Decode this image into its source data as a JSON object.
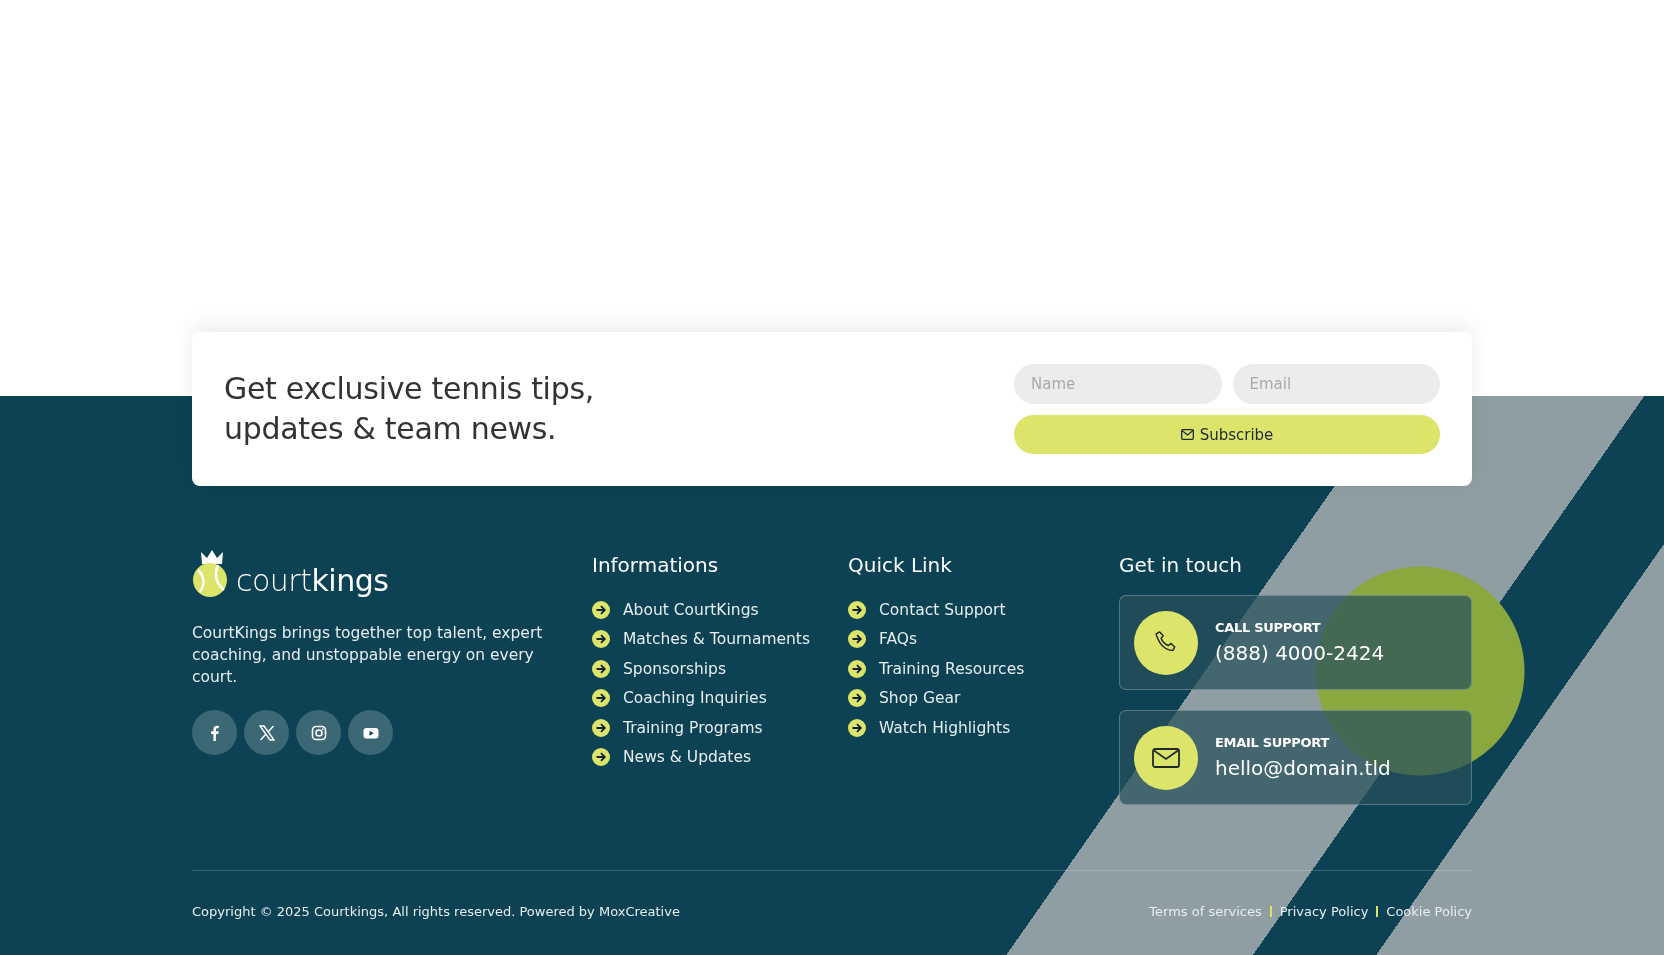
{
  "newsletter": {
    "heading": "Get exclusive tennis tips,\nupdates & team news.",
    "name_field": {
      "placeholder": "Name"
    },
    "email_field": {
      "placeholder": "Email"
    },
    "button": "Subscribe"
  },
  "brand": {
    "logo": "court**kings**",
    "description": "CourtKings brings together top talent, expert coaching, and unstoppable energy on every court.",
    "socials": [
      {
        "kind": "facebook"
      },
      {
        "kind": "x"
      },
      {
        "kind": "instagram"
      },
      {
        "kind": "youtube"
      }
    ]
  },
  "informations": {
    "title": "Informations",
    "links": [
      "About CourtKings",
      "Matches & Tournaments",
      "Sponsorships",
      "Coaching Inquiries",
      "Training Programs",
      "News & Updates"
    ]
  },
  "quick_link": {
    "title": "Quick Link",
    "links": [
      "Contact Support",
      "FAQs",
      "Training Resources",
      "Shop Gear",
      "Watch Highlights"
    ]
  },
  "get_in_touch": {
    "title": "Get in touch",
    "contacts": [
      {
        "kind": "phone",
        "label": "CALL SUPPORT",
        "value": "(888) 4000-2424"
      },
      {
        "kind": "email",
        "label": "EMAIL SUPPORT",
        "value": "hello@domain.tld"
      }
    ]
  },
  "bottom": {
    "copyright": "Copyright © 2025 Courtkings, All rights reserved. Powered by MoxCreative",
    "links": [
      "Terms of services",
      "Privacy Policy",
      "Cookie Policy"
    ]
  }
}
